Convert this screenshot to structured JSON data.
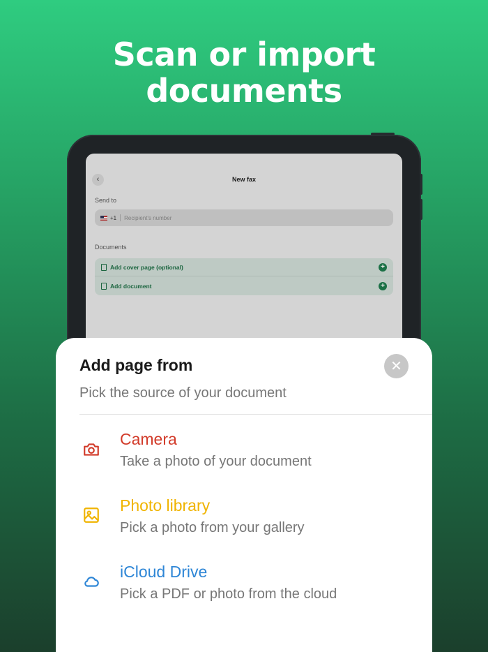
{
  "headline": {
    "line1": "Scan or import",
    "line2": "documents"
  },
  "screen": {
    "back_icon": "‹",
    "title": "New fax",
    "send_to_label": "Send to",
    "country_code": "+1",
    "recipient_placeholder": "Recipient's number",
    "documents_label": "Documents",
    "documents": [
      {
        "label": "Add cover page (optional)"
      },
      {
        "label": "Add document"
      }
    ],
    "plus_icon": "+"
  },
  "sheet": {
    "title": "Add page from",
    "subtitle": "Pick the source of your document",
    "close_icon": "✕",
    "options": [
      {
        "title": "Camera",
        "description": "Take a photo of your document",
        "color": "#d23b2a",
        "icon": "camera-icon"
      },
      {
        "title": "Photo library",
        "description": "Pick a photo from your gallery",
        "color": "#f0b400",
        "icon": "photo-icon"
      },
      {
        "title": "iCloud Drive",
        "description": "Pick a PDF or photo from the cloud",
        "color": "#2e86d6",
        "icon": "cloud-icon"
      }
    ]
  },
  "colors": {
    "accent_green": "#1e7a4c",
    "background_top": "#2fcc80",
    "background_bottom": "#1b3f2c"
  }
}
